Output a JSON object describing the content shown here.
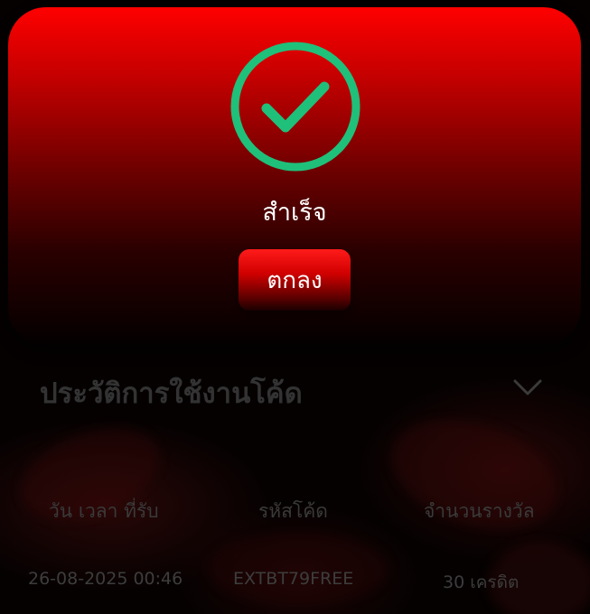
{
  "modal": {
    "status_text": "สำเร็จ",
    "ok_label": "ตกลง",
    "icon": "check-circle-icon",
    "icon_color": "#1fc07a"
  },
  "history": {
    "title": "ประวัติการใช้งานโค้ด",
    "toggle_icon": "chevron-down-icon",
    "columns": [
      "วัน เวลา ที่รับ",
      "รหัสโค้ด",
      "จำนวนรางวัล"
    ],
    "rows": [
      {
        "datetime": "26-08-2025 00:46",
        "code": "EXTBT79FREE",
        "reward": "30 เครดิต"
      }
    ]
  },
  "colors": {
    "modal_top": "#ff0000",
    "modal_bottom": "#030000",
    "accent_green": "#1fc07a",
    "muted_text": "#3a3a3a"
  }
}
